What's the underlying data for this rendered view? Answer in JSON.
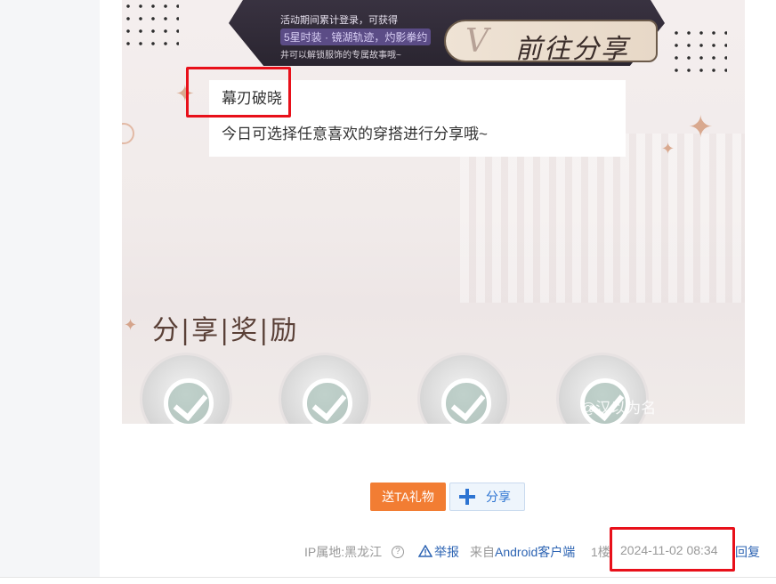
{
  "screenshot": {
    "banner": {
      "line1": "活动期间累计登录，可获得",
      "line2": "5星时装 · 镜湖轨迹，灼影拳约",
      "line3": "井可以解锁服饰的专属故事哦~",
      "go_share": "前往分享"
    },
    "card": {
      "title": "幕刃破晓",
      "desc": "今日可选择任意喜欢的穿搭进行分享哦~"
    },
    "rewards_title": "分|享|奖|励",
    "watermark": "@汉以为名"
  },
  "actions": {
    "gift_label": "送TA礼物",
    "share_label": "分享"
  },
  "post_meta": {
    "ip_location": "IP属地:黑龙江",
    "report_label": "举报",
    "from_prefix": "来自",
    "client_link": "Android客户端",
    "floor": "1楼",
    "timestamp": "2024-11-02 08:34",
    "reply_label": "回复"
  },
  "colors": {
    "highlight_box": "#e8101a",
    "gift_button": "#f27d33",
    "link_blue": "#2d64b3"
  }
}
